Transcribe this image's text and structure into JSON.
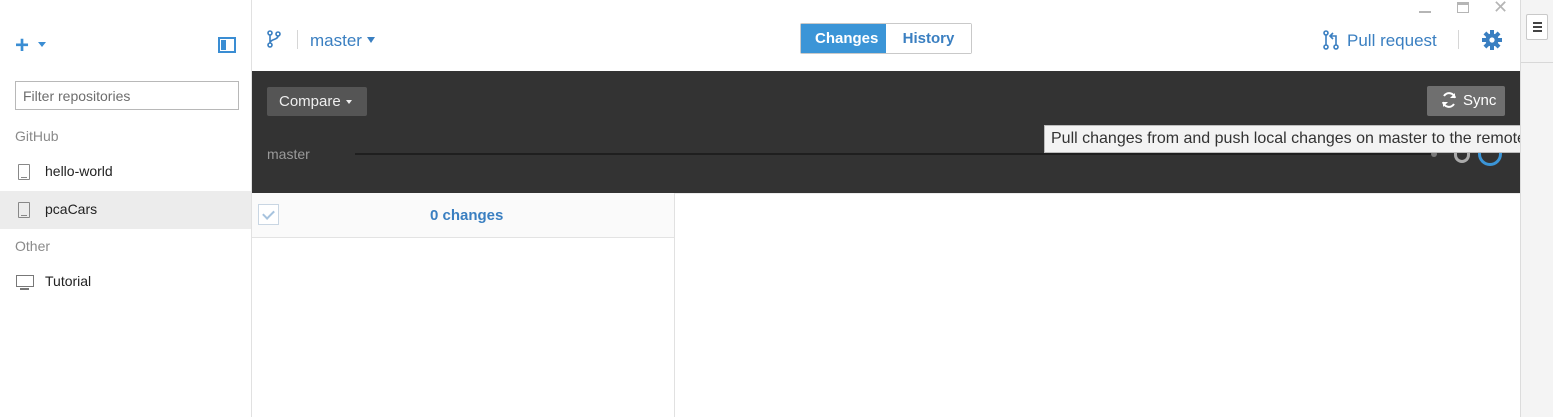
{
  "sidebar": {
    "filter_placeholder": "Filter repositories",
    "sections": {
      "github": "GitHub",
      "other": "Other"
    },
    "repos": [
      {
        "label": "hello-world",
        "selected": false
      },
      {
        "label": "pcaCars",
        "selected": true
      }
    ],
    "other_repos": [
      {
        "label": "Tutorial"
      }
    ]
  },
  "header": {
    "branch": "master",
    "tabs": [
      {
        "label": "Changes",
        "active": true
      },
      {
        "label": "History",
        "active": false
      }
    ],
    "pull_request": "Pull request"
  },
  "band": {
    "compare_label": "Compare",
    "sync_label": "Sync",
    "branch_track_label": "master",
    "tooltip": "Pull changes from and push local changes on master to the remote"
  },
  "changes": {
    "count_label": "0 changes"
  },
  "colors": {
    "accent": "#3b95d7",
    "link": "#3a7fc1",
    "band_bg": "#333333"
  }
}
